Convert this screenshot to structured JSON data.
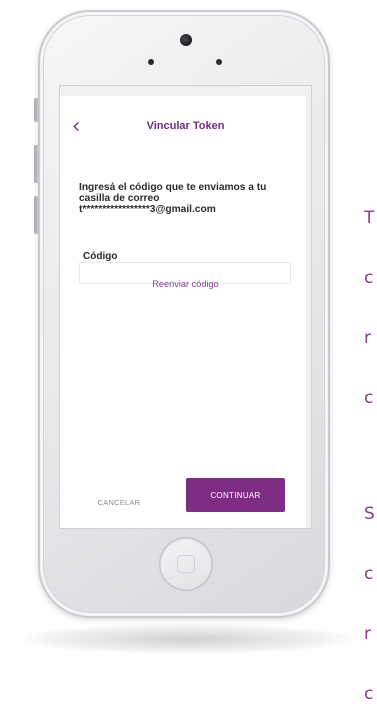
{
  "screen": {
    "title": "Vincular Token",
    "instruction": "Ingresá el código que te enviamos a tu casilla de correo",
    "email": "t*****************3@gmail.com",
    "code_label": "Código",
    "code_value": "",
    "code_placeholder": "",
    "resend_label": "Reenviar código",
    "cancel_label": "CANCELAR",
    "continue_label": "CONTINUAR"
  },
  "side_text": {
    "lines_group_1": [
      "T",
      "c",
      "r",
      "c"
    ],
    "lines_group_2": [
      "S",
      "c",
      "r",
      "c"
    ]
  },
  "colors": {
    "brand": "#7e2d85",
    "title": "#6d2f7e",
    "link": "#8a3f96"
  },
  "icons": {
    "back": "chevron-left-icon"
  }
}
